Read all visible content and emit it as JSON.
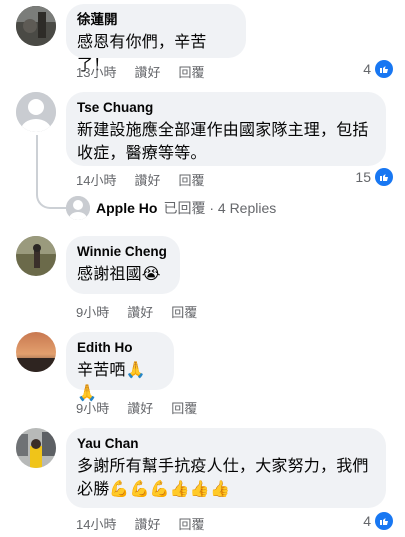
{
  "comments": [
    {
      "name": "徐蓮開",
      "text": "感恩有你們，辛苦了！",
      "time": "13小時",
      "like_label": "讚好",
      "reply_label": "回覆",
      "reaction_count": "4"
    },
    {
      "name": "Tse Chuang",
      "text": "新建設施應全部運作由國家隊主理，包括收症，醫療等等。",
      "time": "14小時",
      "like_label": "讚好",
      "reply_label": "回覆",
      "reaction_count": "15",
      "replies_summary": {
        "author": "Apple  Ho",
        "suffix": "已回覆 · 4 Replies"
      }
    },
    {
      "name": "Winnie  Cheng",
      "text": "感謝祖國😭",
      "time": "9小時",
      "like_label": "讚好",
      "reply_label": "回覆"
    },
    {
      "name": "Edith Ho",
      "text": "辛苦哂🙏🙏",
      "time": "9小時",
      "like_label": "讚好",
      "reply_label": "回覆"
    },
    {
      "name": "Yau Chan",
      "text": "多謝所有幫手抗疫人仕，大家努力，我們必勝💪💪💪👍👍👍",
      "time": "14小時",
      "like_label": "讚好",
      "reply_label": "回覆",
      "reaction_count": "4"
    }
  ],
  "colors": {
    "bubble": "#f0f2f5",
    "meta_text": "#65676b",
    "like_blue": "#1877f2"
  }
}
